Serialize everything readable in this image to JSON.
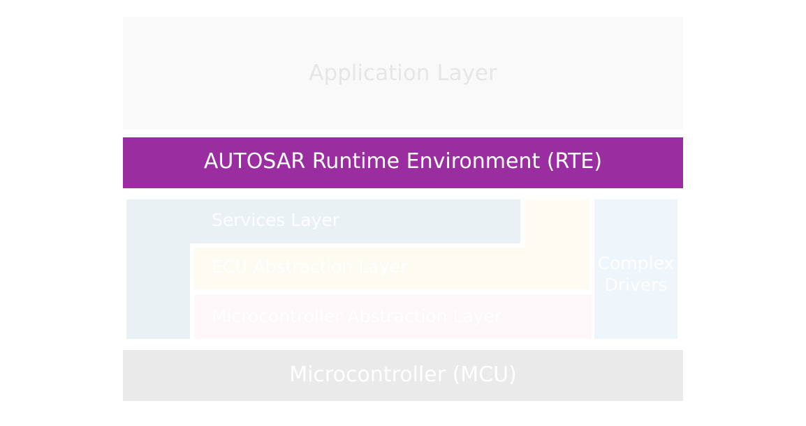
{
  "layers": {
    "application": "Application Layer",
    "rte": "AUTOSAR Runtime Environment (RTE)",
    "services": "Services Layer",
    "ecu_abstraction": "ECU Abstraction Layer",
    "mcal": "Microcontroller Abstraction Layer",
    "complex_drivers": "Complex Drivers",
    "mcu": "Microcontroller (MCU)"
  },
  "colors": {
    "rte": "#9a2ea0",
    "application": "#f9f9f9",
    "services": "#eaf1f5",
    "ecu_abstraction": "#fdfbf2",
    "mcal": "#fdf7fa",
    "complex_drivers": "#eef5fb",
    "mcu": "#e9eae9"
  }
}
